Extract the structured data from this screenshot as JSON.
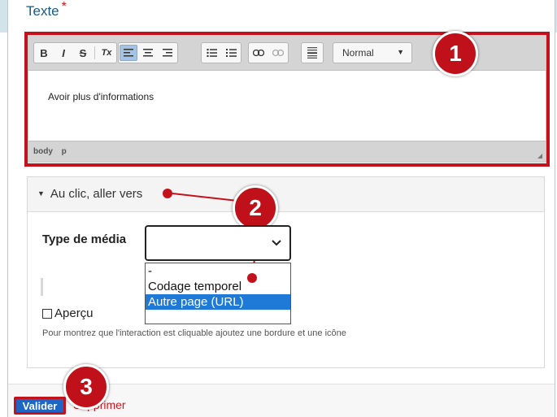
{
  "field": {
    "label": "Texte",
    "required_mark": "*"
  },
  "editor": {
    "toolbar": {
      "basic": [
        "B",
        "I",
        "S",
        "Tx"
      ],
      "align": [
        "align-left",
        "align-center",
        "align-right"
      ],
      "lists": [
        "bulleted-list",
        "numbered-list"
      ],
      "links": [
        "link",
        "unlink"
      ],
      "format_value": "Normal"
    },
    "content": "Avoir plus d'informations",
    "path": [
      "body",
      "p"
    ]
  },
  "section": {
    "title": "Au clic, aller vers",
    "media_type_label": "Type de média",
    "media_type_value": "",
    "options": [
      "-",
      "Codage temporel",
      "Autre page (URL)"
    ],
    "selected_option": "Autre page (URL)",
    "preview_label": "Aperçu",
    "hint": "Pour montrez que l'interaction est cliquable ajoutez une bordure et une icône"
  },
  "footer": {
    "validate_label": "Valider",
    "delete_label": "Supprimer"
  },
  "callouts": [
    "1",
    "2",
    "3"
  ],
  "colors": {
    "accent": "#c4121c",
    "primary": "#1e66c6",
    "label": "#1c5a83",
    "selected": "#1e7ad6"
  }
}
